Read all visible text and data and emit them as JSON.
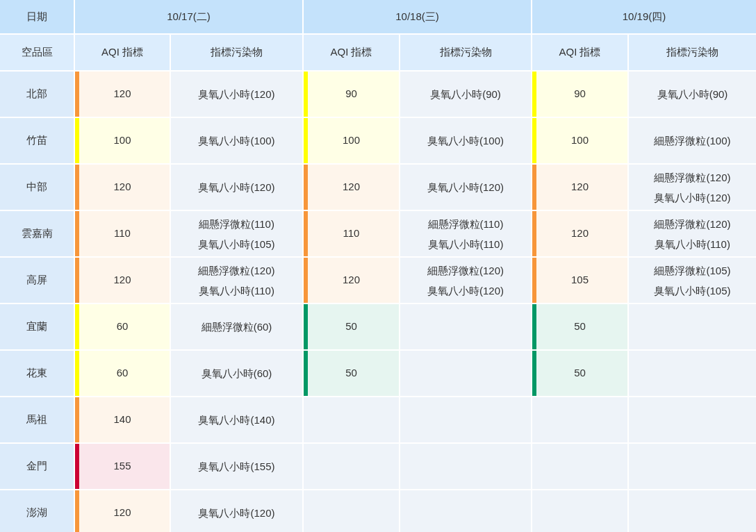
{
  "header": {
    "date_label": "日期",
    "region_label": "空品區",
    "days": [
      {
        "date": "10/17(二)",
        "aqi_label": "AQI 指標",
        "pollutant_label": "指標污染物"
      },
      {
        "date": "10/18(三)",
        "aqi_label": "AQI 指標",
        "pollutant_label": "指標污染物"
      },
      {
        "date": "10/19(四)",
        "aqi_label": "AQI 指標",
        "pollutant_label": "指標污染物"
      }
    ]
  },
  "rows": [
    {
      "region": "北部",
      "forecasts": [
        {
          "aqi": "120",
          "color": "#f7963a",
          "pollutants": [
            "臭氧八小時(120)"
          ]
        },
        {
          "aqi": "90",
          "color": "#ffff00",
          "pollutants": [
            "臭氧八小時(90)"
          ]
        },
        {
          "aqi": "90",
          "color": "#ffff00",
          "pollutants": [
            "臭氧八小時(90)"
          ]
        }
      ]
    },
    {
      "region": "竹苗",
      "forecasts": [
        {
          "aqi": "100",
          "color": "#ffff00",
          "pollutants": [
            "臭氧八小時(100)"
          ]
        },
        {
          "aqi": "100",
          "color": "#ffff00",
          "pollutants": [
            "臭氧八小時(100)"
          ]
        },
        {
          "aqi": "100",
          "color": "#ffff00",
          "pollutants": [
            "細懸浮微粒(100)"
          ]
        }
      ]
    },
    {
      "region": "中部",
      "forecasts": [
        {
          "aqi": "120",
          "color": "#f7963a",
          "pollutants": [
            "臭氧八小時(120)"
          ]
        },
        {
          "aqi": "120",
          "color": "#f7963a",
          "pollutants": [
            "臭氧八小時(120)"
          ]
        },
        {
          "aqi": "120",
          "color": "#f7963a",
          "pollutants": [
            "細懸浮微粒(120)",
            "臭氧八小時(120)"
          ]
        }
      ]
    },
    {
      "region": "雲嘉南",
      "forecasts": [
        {
          "aqi": "110",
          "color": "#f7963a",
          "pollutants": [
            "細懸浮微粒(110)",
            "臭氧八小時(105)"
          ]
        },
        {
          "aqi": "110",
          "color": "#f7963a",
          "pollutants": [
            "細懸浮微粒(110)",
            "臭氧八小時(110)"
          ]
        },
        {
          "aqi": "120",
          "color": "#f7963a",
          "pollutants": [
            "細懸浮微粒(120)",
            "臭氧八小時(110)"
          ]
        }
      ]
    },
    {
      "region": "高屏",
      "forecasts": [
        {
          "aqi": "120",
          "color": "#f7963a",
          "pollutants": [
            "細懸浮微粒(120)",
            "臭氧八小時(110)"
          ]
        },
        {
          "aqi": "120",
          "color": "#f7963a",
          "pollutants": [
            "細懸浮微粒(120)",
            "臭氧八小時(120)"
          ]
        },
        {
          "aqi": "105",
          "color": "#f7963a",
          "pollutants": [
            "細懸浮微粒(105)",
            "臭氧八小時(105)"
          ]
        }
      ]
    },
    {
      "region": "宜蘭",
      "forecasts": [
        {
          "aqi": "60",
          "color": "#ffff00",
          "pollutants": [
            "細懸浮微粒(60)"
          ]
        },
        {
          "aqi": "50",
          "color": "#009865"
        },
        {
          "aqi": "50",
          "color": "#009865"
        }
      ]
    },
    {
      "region": "花東",
      "forecasts": [
        {
          "aqi": "60",
          "color": "#ffff00",
          "pollutants": [
            "臭氧八小時(60)"
          ]
        },
        {
          "aqi": "50",
          "color": "#009865"
        },
        {
          "aqi": "50",
          "color": "#009865"
        }
      ]
    },
    {
      "region": "馬祖",
      "forecasts": [
        {
          "aqi": "140",
          "color": "#f7963a",
          "pollutants": [
            "臭氧八小時(140)"
          ]
        }
      ]
    },
    {
      "region": "金門",
      "forecasts": [
        {
          "aqi": "155",
          "color": "#cc0033",
          "pollutants": [
            "臭氧八小時(155)"
          ]
        }
      ]
    },
    {
      "region": "澎湖",
      "forecasts": [
        {
          "aqi": "120",
          "color": "#f7963a",
          "pollutants": [
            "臭氧八小時(120)"
          ]
        }
      ]
    }
  ]
}
